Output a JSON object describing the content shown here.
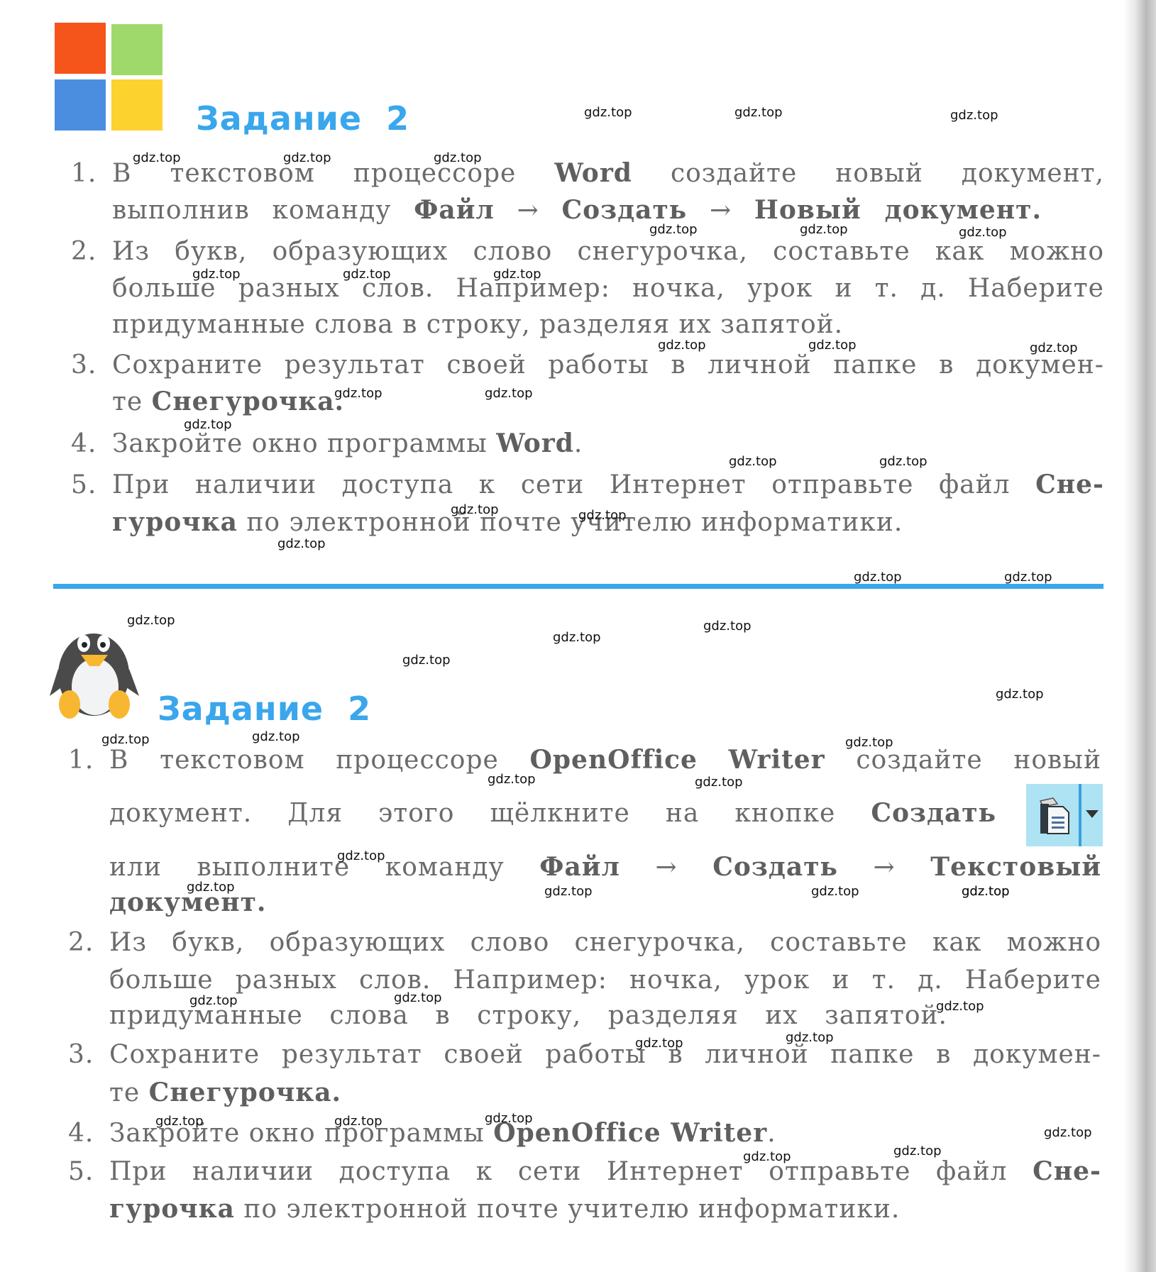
{
  "sections": [
    {
      "logo": "windows-logo",
      "title": "Задание  2",
      "steps": [
        {
          "num": "1.",
          "lines": [
            [
              "В",
              "текстовом",
              "процессоре",
              {
                "b": "Word"
              },
              "создайте",
              "новый",
              "документ,"
            ],
            [
              "выполнив команду ",
              {
                "b": "Файл"
              },
              " → ",
              {
                "b": "Создать"
              },
              " → ",
              {
                "b": "Новый документ."
              }
            ]
          ]
        },
        {
          "num": "2.",
          "lines": [
            [
              "Из",
              "букв,",
              "образующих",
              "слово",
              "снегурочка,",
              "составьте",
              "как",
              "можно"
            ],
            [
              "больше",
              "разных",
              "слов.",
              "Например:",
              "ночка,",
              "урок",
              "и",
              "т.",
              "д.",
              "Наберите"
            ],
            [
              "придуманные слова в строку, разделяя их запятой."
            ]
          ]
        },
        {
          "num": "3.",
          "lines": [
            [
              "Сохраните",
              "результат",
              "своей",
              "работы",
              "в",
              "личной",
              "папке",
              "в",
              "докумен-"
            ],
            [
              "те ",
              {
                "b": "Снегурочка."
              }
            ]
          ]
        },
        {
          "num": "4.",
          "lines": [
            [
              "Закройте окно программы ",
              {
                "b": "Word"
              },
              "."
            ]
          ]
        },
        {
          "num": "5.",
          "lines": [
            [
              "При",
              "наличии",
              "доступа",
              "к",
              "сети",
              "Интернет",
              "отправьте",
              "файл",
              {
                "b": "Сне-"
              }
            ],
            [
              {
                "b": "гурочка"
              },
              " по электронной почте учителю информатики."
            ]
          ]
        }
      ]
    },
    {
      "logo": "linux-penguin",
      "title": "Задание  2",
      "steps": [
        {
          "num": "1.",
          "lines": [
            [
              "В",
              "текстовом",
              "процессоре",
              {
                "b": "OpenOffice"
              },
              {
                "b": "Writer"
              },
              "создайте",
              "новый"
            ],
            [
              "документ.",
              "Для",
              "этого",
              "щёлкните",
              "на",
              "кнопке",
              {
                "b": "Создать"
              }
            ],
            [
              "или",
              "выполните",
              "команду",
              {
                "b": "Файл"
              },
              "→",
              {
                "b": "Создать"
              },
              "→",
              {
                "b": "Текстовый"
              }
            ],
            [
              {
                "b": "документ."
              }
            ]
          ]
        },
        {
          "num": "2.",
          "lines": [
            [
              "Из",
              "букв,",
              "образующих",
              "слово",
              "снегурочка,",
              "составьте",
              "как",
              "можно"
            ],
            [
              "больше",
              "разных",
              "слов.",
              "Например:",
              "ночка,",
              "урок",
              "и",
              "т.",
              "д.",
              "Наберите"
            ],
            [
              "придуманные",
              "слова",
              "в",
              "строку,",
              "разделяя",
              "их",
              "запятой."
            ]
          ]
        },
        {
          "num": "3.",
          "lines": [
            [
              "Сохраните",
              "результат",
              "своей",
              "работы",
              "в",
              "личной",
              "папке",
              "в",
              "докумен-"
            ],
            [
              "те ",
              {
                "b": "Снегурочка."
              }
            ]
          ]
        },
        {
          "num": "4.",
          "lines": [
            [
              "Закройте окно программы ",
              {
                "b": "OpenOffice Writer"
              },
              "."
            ]
          ]
        },
        {
          "num": "5.",
          "lines": [
            [
              "При",
              "наличии",
              "доступа",
              "к",
              "сети",
              "Интернет",
              "отправьте",
              "файл",
              {
                "b": "Сне-"
              }
            ],
            [
              {
                "b": "гурочка"
              },
              " по электронной почте учителю информатики."
            ]
          ]
        }
      ],
      "inline_icon": "new-document-button-icon"
    }
  ],
  "watermark": "gdz.top",
  "colors": {
    "title": "#3aa6ec",
    "divider": "#3aa6ec",
    "text": "#6b6b6b"
  }
}
